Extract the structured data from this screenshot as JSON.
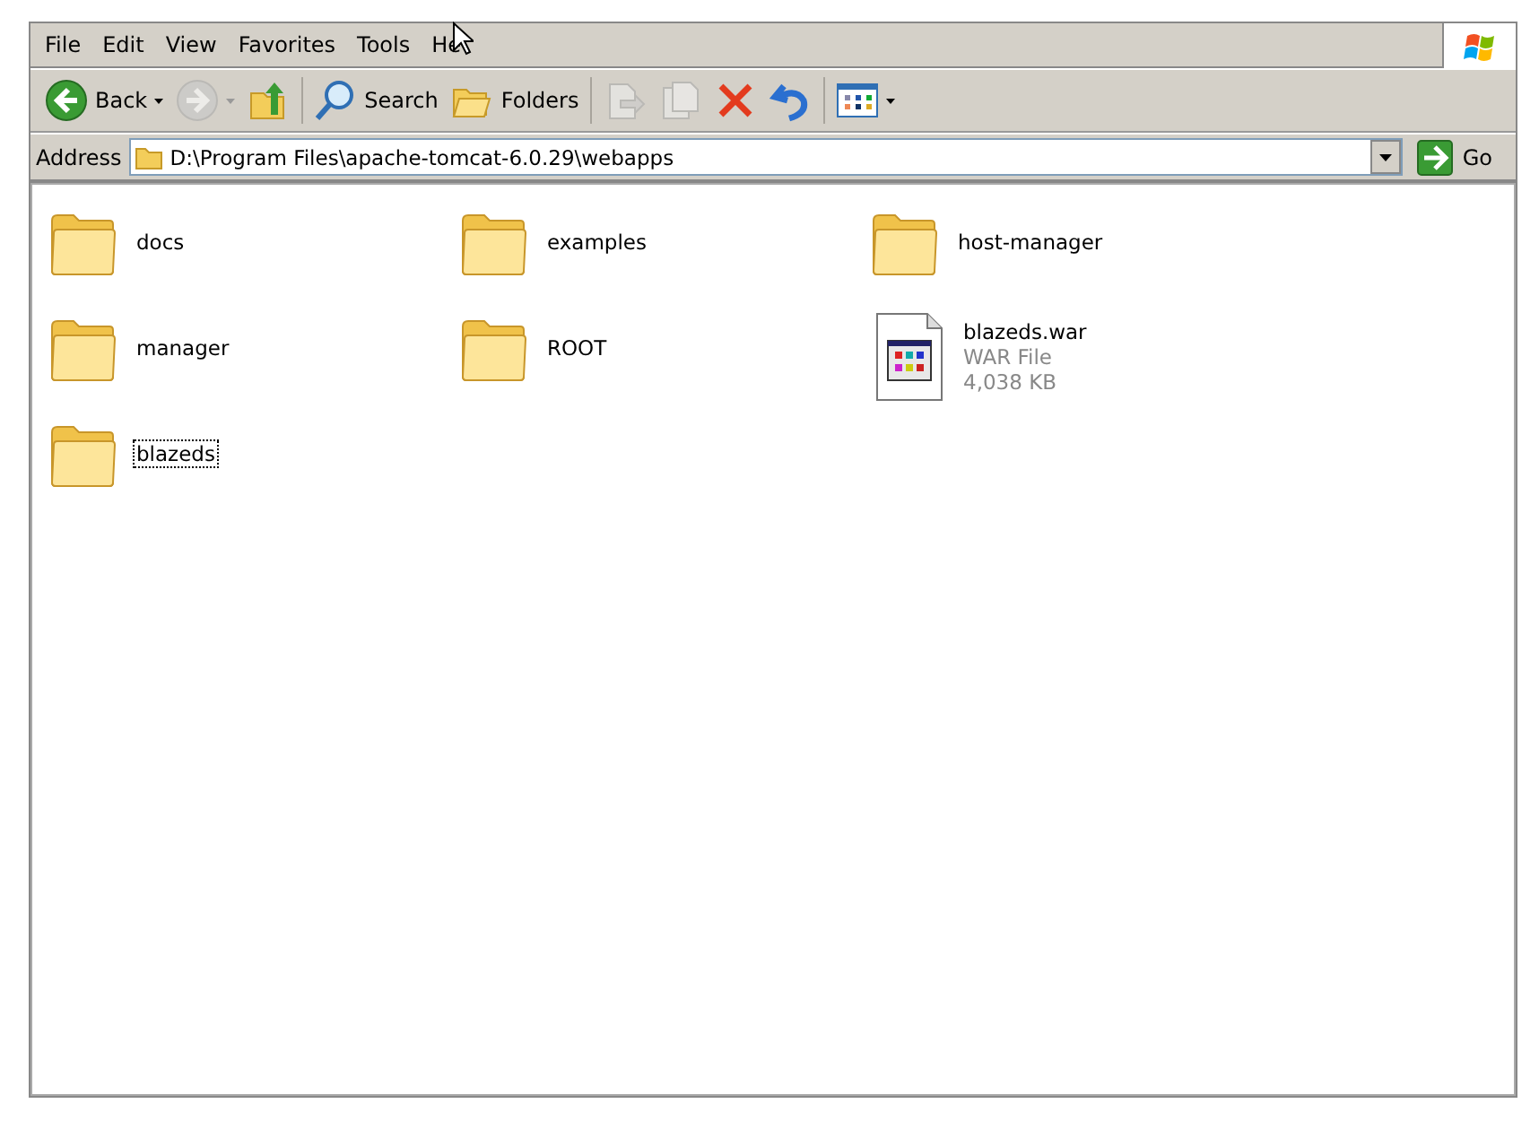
{
  "menu_bar": {
    "items": [
      {
        "label": "File"
      },
      {
        "label": "Edit"
      },
      {
        "label": "View"
      },
      {
        "label": "Favorites"
      },
      {
        "label": "Tools"
      },
      {
        "label": "He"
      }
    ]
  },
  "toolbar": {
    "groups": [
      [
        {
          "kind": "back",
          "label": "Back",
          "dropdown": true,
          "disabled": false
        },
        {
          "kind": "forward",
          "dropdown": true,
          "disabled": true
        },
        {
          "kind": "up",
          "dropdown": false,
          "disabled": false
        }
      ],
      [
        {
          "kind": "search",
          "label": "Search",
          "dropdown": false,
          "disabled": false
        },
        {
          "kind": "folders",
          "label": "Folders",
          "dropdown": false,
          "disabled": false
        }
      ],
      [
        {
          "kind": "move",
          "dropdown": false,
          "disabled": true
        },
        {
          "kind": "copy",
          "dropdown": false,
          "disabled": true
        },
        {
          "kind": "delete",
          "dropdown": false,
          "disabled": false
        },
        {
          "kind": "undo",
          "dropdown": false,
          "disabled": false
        }
      ],
      [
        {
          "kind": "views",
          "dropdown": true,
          "disabled": false
        }
      ]
    ]
  },
  "address_bar": {
    "label": "Address",
    "value": "D:\\Program Files\\apache-tomcat-6.0.29\\webapps",
    "go_label": "Go"
  },
  "items": [
    {
      "kind": "folder",
      "name": "docs",
      "focused": false
    },
    {
      "kind": "folder",
      "name": "examples",
      "focused": false
    },
    {
      "kind": "folder",
      "name": "host-manager",
      "focused": false
    },
    {
      "kind": "folder",
      "name": "manager",
      "focused": false
    },
    {
      "kind": "folder",
      "name": "ROOT",
      "focused": false
    },
    {
      "kind": "file",
      "name": "blazeds.war",
      "type": "WAR File",
      "size": "4,038 KB",
      "focused": false
    },
    {
      "kind": "folder",
      "name": "blazeds",
      "focused": true
    }
  ]
}
